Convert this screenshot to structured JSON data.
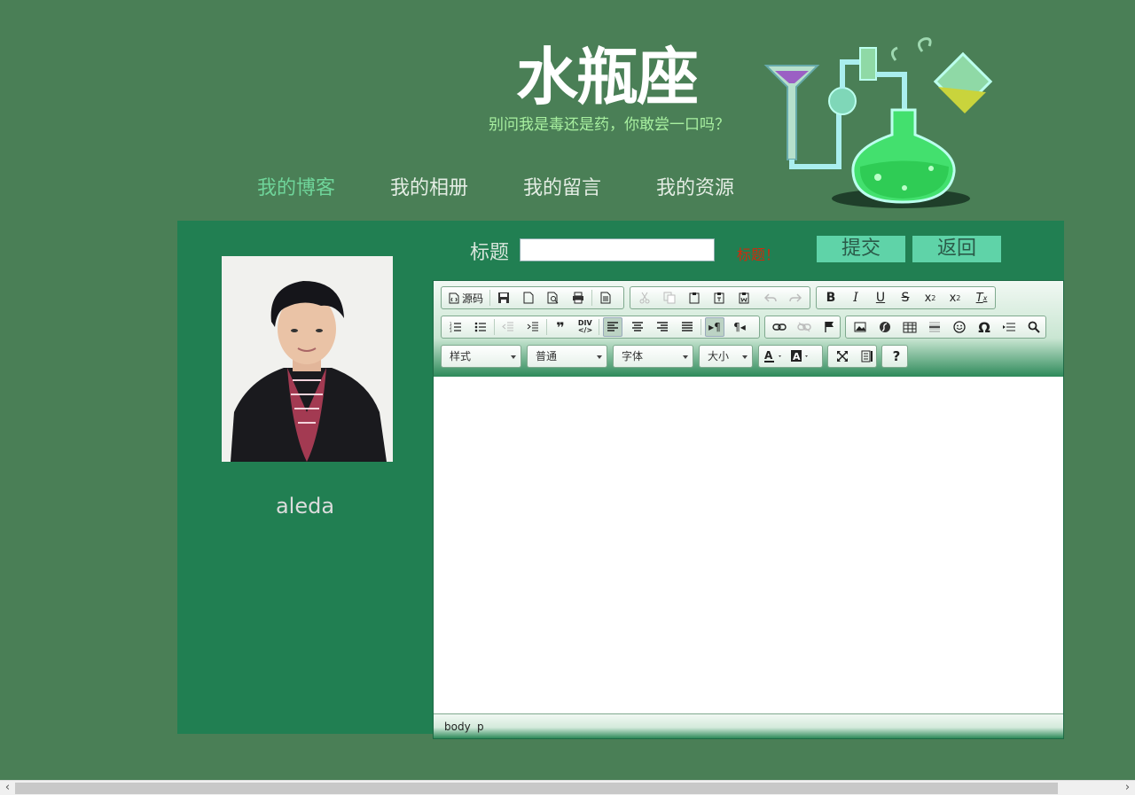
{
  "header": {
    "title": "水瓶座",
    "slogan": "别问我是毒还是药，你敢尝一口吗？"
  },
  "nav": {
    "items": [
      {
        "label": "我的博客",
        "active": true
      },
      {
        "label": "我的相册",
        "active": false
      },
      {
        "label": "我的留言",
        "active": false
      },
      {
        "label": "我的资源",
        "active": false
      }
    ]
  },
  "profile": {
    "username": "aleda"
  },
  "post_form": {
    "title_label": "标题",
    "title_value": "",
    "title_warning": "标题！",
    "submit_label": "提交",
    "back_label": "返回"
  },
  "editor": {
    "toolbar": {
      "source_label": "源码",
      "style_combo": "样式",
      "format_combo": "普通",
      "font_combo": "字体",
      "size_combo": "大小"
    },
    "content": "",
    "status_path": [
      "body",
      "p"
    ]
  },
  "colors": {
    "page_bg": "#4a7f56",
    "panel_bg": "#217f52",
    "nav_active": "#6fd59a",
    "button_bg": "#5fd3a8",
    "warning": "#d12a0c"
  }
}
